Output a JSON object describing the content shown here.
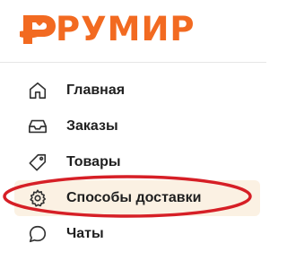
{
  "brand": {
    "logo_text": "РУМИР",
    "logo_icon": "hand-heart-logo",
    "color": "#f26a21"
  },
  "nav": {
    "items": [
      {
        "label": "Главная",
        "icon": "home-icon"
      },
      {
        "label": "Заказы",
        "icon": "inbox-icon"
      },
      {
        "label": "Товары",
        "icon": "tag-icon"
      },
      {
        "label": "Способы доставки",
        "icon": "gear-icon",
        "active": true
      },
      {
        "label": "Чаты",
        "icon": "chat-bubble-icon"
      }
    ],
    "active_background": "#fbf1e3",
    "highlight_ring_color": "#d61f26"
  }
}
